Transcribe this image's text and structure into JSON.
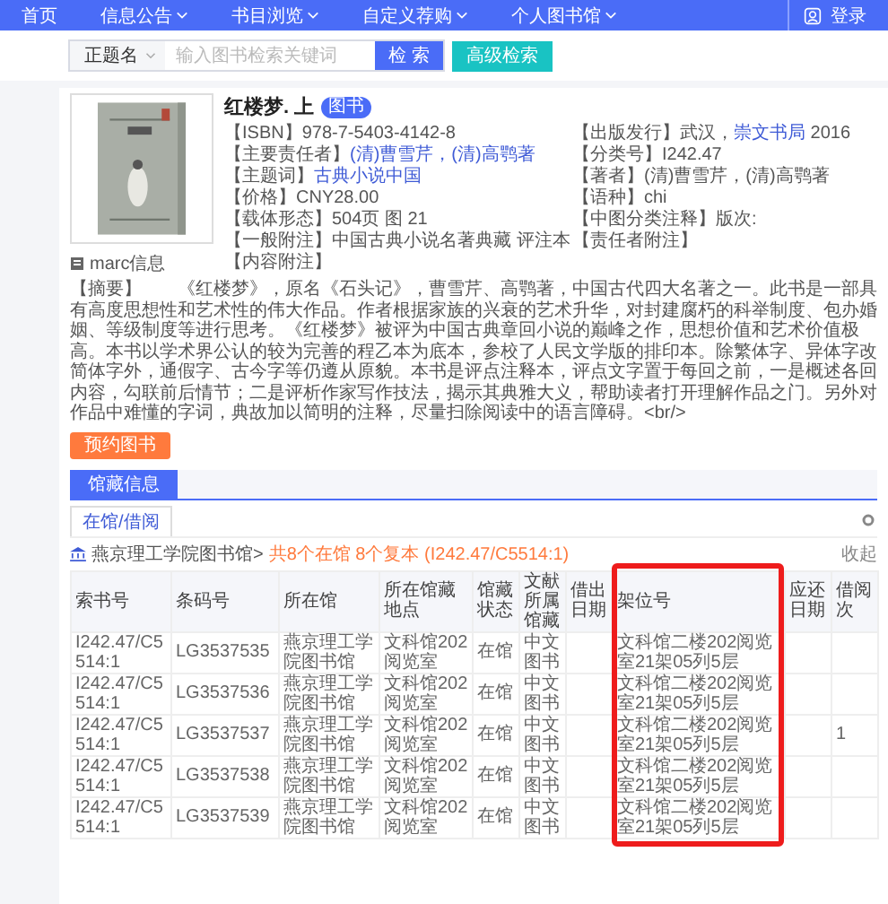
{
  "nav": {
    "items": [
      {
        "label": "首页",
        "dropdown": false
      },
      {
        "label": "信息公告",
        "dropdown": true
      },
      {
        "label": "书目浏览",
        "dropdown": true
      },
      {
        "label": "自定义荐购",
        "dropdown": true
      },
      {
        "label": "个人图书馆",
        "dropdown": true
      }
    ],
    "login": "登录"
  },
  "search": {
    "field_select": "正题名",
    "placeholder": "输入图书检索关键词",
    "button": "检 索",
    "advanced": "高级检索"
  },
  "book": {
    "title": "红楼梦. 上",
    "badge": "图书",
    "marc": "marc信息",
    "fields": [
      {
        "label": "【ISBN】",
        "parts": [
          {
            "text": "978-7-5403-4142-8",
            "link": false
          }
        ]
      },
      {
        "label": "【出版发行】",
        "parts": [
          {
            "text": "武汉，",
            "link": false
          },
          {
            "text": "崇文书局",
            "link": true
          },
          {
            "text": " 2016",
            "link": false
          }
        ]
      },
      {
        "label": "【主要责任者】",
        "parts": [
          {
            "text": "(清)曹雪芹，(清)高鹗著",
            "link": true
          }
        ]
      },
      {
        "label": "【分类号】",
        "parts": [
          {
            "text": "I242.47",
            "link": false
          }
        ]
      },
      {
        "label": "【主题词】",
        "parts": [
          {
            "text": "古典小说中国",
            "link": true
          }
        ]
      },
      {
        "label": "【著者】",
        "parts": [
          {
            "text": "(清)曹雪芹，(清)高鹗著",
            "link": false
          }
        ]
      },
      {
        "label": "【价格】",
        "parts": [
          {
            "text": "CNY28.00",
            "link": false
          }
        ]
      },
      {
        "label": "【语种】",
        "parts": [
          {
            "text": "chi",
            "link": false
          }
        ]
      },
      {
        "label": "【载体形态】",
        "parts": [
          {
            "text": "504页 图 21",
            "link": false
          }
        ]
      },
      {
        "label": "【中图分类注释】",
        "parts": [
          {
            "text": "版次:",
            "link": false
          }
        ]
      },
      {
        "label": "【一般附注】",
        "parts": [
          {
            "text": "中国古典小说名著典藏 评注本",
            "link": false
          }
        ]
      },
      {
        "label": "【责任者附注】"
      },
      {
        "label": "【内容附注】"
      }
    ],
    "abstract_label": "【摘要】",
    "abstract": "《红楼梦》，原名《石头记》，曹雪芹、高鹗著，中国古代四大名著之一。此书是一部具有高度思想性和艺术性的伟大作品。作者根据家族的兴衰的艺术升华，对封建腐朽的科举制度、包办婚姻、等级制度等进行思考。《红楼梦》被评为中国古典章回小说的巅峰之作，思想价值和艺术价值极高。本书以学术界公认的较为完善的程乙本为底本，参校了人民文学版的排印本。除繁体字、异体字改简体字外，通假字、古今字等仍遵从原貌。本书是评点注释本，评点文字置于每回之前，一是概述各回内容，勾联前后情节；二是评析作家写作技法，揭示其典雅大义，帮助读者打开理解作品之门。另外对作品中难懂的字词，典故加以简明的注释，尽量扫除阅读中的语言障碍。<br/>",
    "action": "预约图书"
  },
  "holdings": {
    "tabs": [
      {
        "label": "馆藏信息",
        "selected": true
      }
    ],
    "subtabs": [
      {
        "label": "在馆/借阅",
        "selected": true
      }
    ],
    "library": "燕京理工学院图书馆>",
    "summary": "共8个在馆 8个复本 (I242.47/C5514:1)",
    "collapse": "收起",
    "columns": [
      "索书号",
      "条码号",
      "所在馆",
      "所在馆藏地点",
      "馆藏状态",
      "文献所属馆藏",
      "借出日期",
      "架位号",
      "应还日期",
      "借阅次"
    ],
    "rows": [
      [
        "I242.47/C5514:1",
        "LG3537535",
        "燕京理工学院图书馆",
        "文科馆202阅览室",
        "在馆",
        "中文图书",
        "",
        "文科馆二楼202阅览室21架05列5层",
        "",
        ""
      ],
      [
        "I242.47/C5514:1",
        "LG3537536",
        "燕京理工学院图书馆",
        "文科馆202阅览室",
        "在馆",
        "中文图书",
        "",
        "文科馆二楼202阅览室21架05列5层",
        "",
        ""
      ],
      [
        "I242.47/C5514:1",
        "LG3537537",
        "燕京理工学院图书馆",
        "文科馆202阅览室",
        "在馆",
        "中文图书",
        "",
        "文科馆二楼202阅览室21架05列5层",
        "",
        "1"
      ],
      [
        "I242.47/C5514:1",
        "LG3537538",
        "燕京理工学院图书馆",
        "文科馆202阅览室",
        "在馆",
        "中文图书",
        "",
        "文科馆二楼202阅览室21架05列5层",
        "",
        ""
      ],
      [
        "I242.47/C5514:1",
        "LG3537539",
        "燕京理工学院图书馆",
        "文科馆202阅览室",
        "在馆",
        "中文图书",
        "",
        "文科馆二楼202阅览室21架05列5层",
        "",
        ""
      ]
    ]
  }
}
